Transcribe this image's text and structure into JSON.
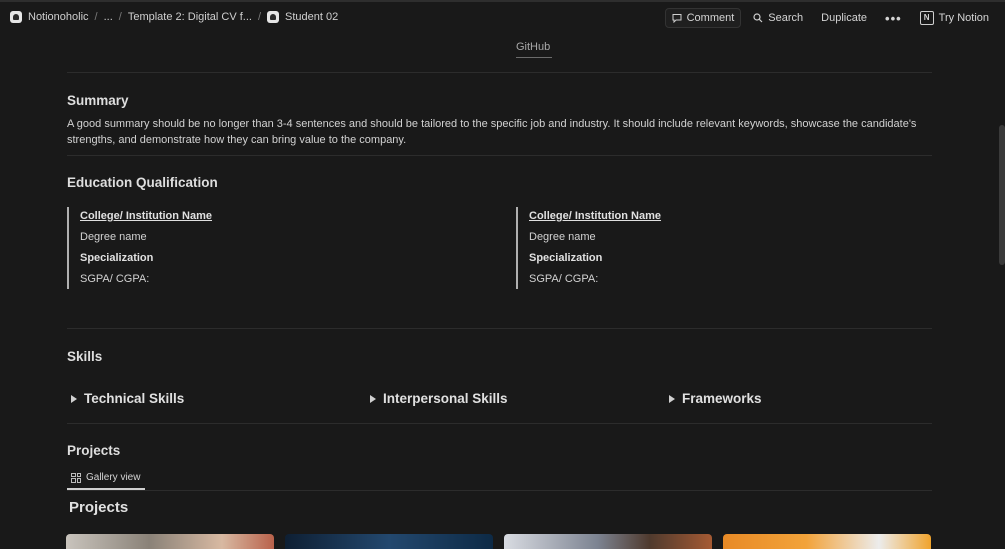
{
  "breadcrumb": {
    "workspace": "Notionoholic",
    "ellipsis": "...",
    "template": "Template 2: Digital CV f...",
    "page": "Student 02",
    "separator": "/"
  },
  "topbar": {
    "comment": "Comment",
    "search": "Search",
    "duplicate": "Duplicate",
    "more": "•••",
    "try_notion": "Try Notion",
    "notion_logo_letter": "N"
  },
  "github_link": "GitHub",
  "summary": {
    "heading": "Summary",
    "text": "A good summary should be no longer than 3-4 sentences and should be tailored to the specific job and industry. It should include relevant keywords, showcase the candidate's strengths, and demonstrate how they can bring value to the company."
  },
  "education": {
    "heading": "Education Qualification",
    "entries": [
      {
        "institution": "College/ Institution Name",
        "degree": "Degree name",
        "specialization": "Specialization",
        "grade": "SGPA/ CGPA:"
      },
      {
        "institution": "College/ Institution Name",
        "degree": "Degree name",
        "specialization": "Specialization",
        "grade": "SGPA/ CGPA:"
      }
    ]
  },
  "skills": {
    "heading": "Skills",
    "toggles": [
      "Technical Skills",
      "Interpersonal Skills",
      "Frameworks"
    ]
  },
  "projects": {
    "heading": "Projects",
    "view_tab": "Gallery view",
    "gallery_title": "Projects"
  },
  "colors": {
    "background": "#191919",
    "text": "#d4d4d4",
    "divider": "#2c2c2c"
  }
}
